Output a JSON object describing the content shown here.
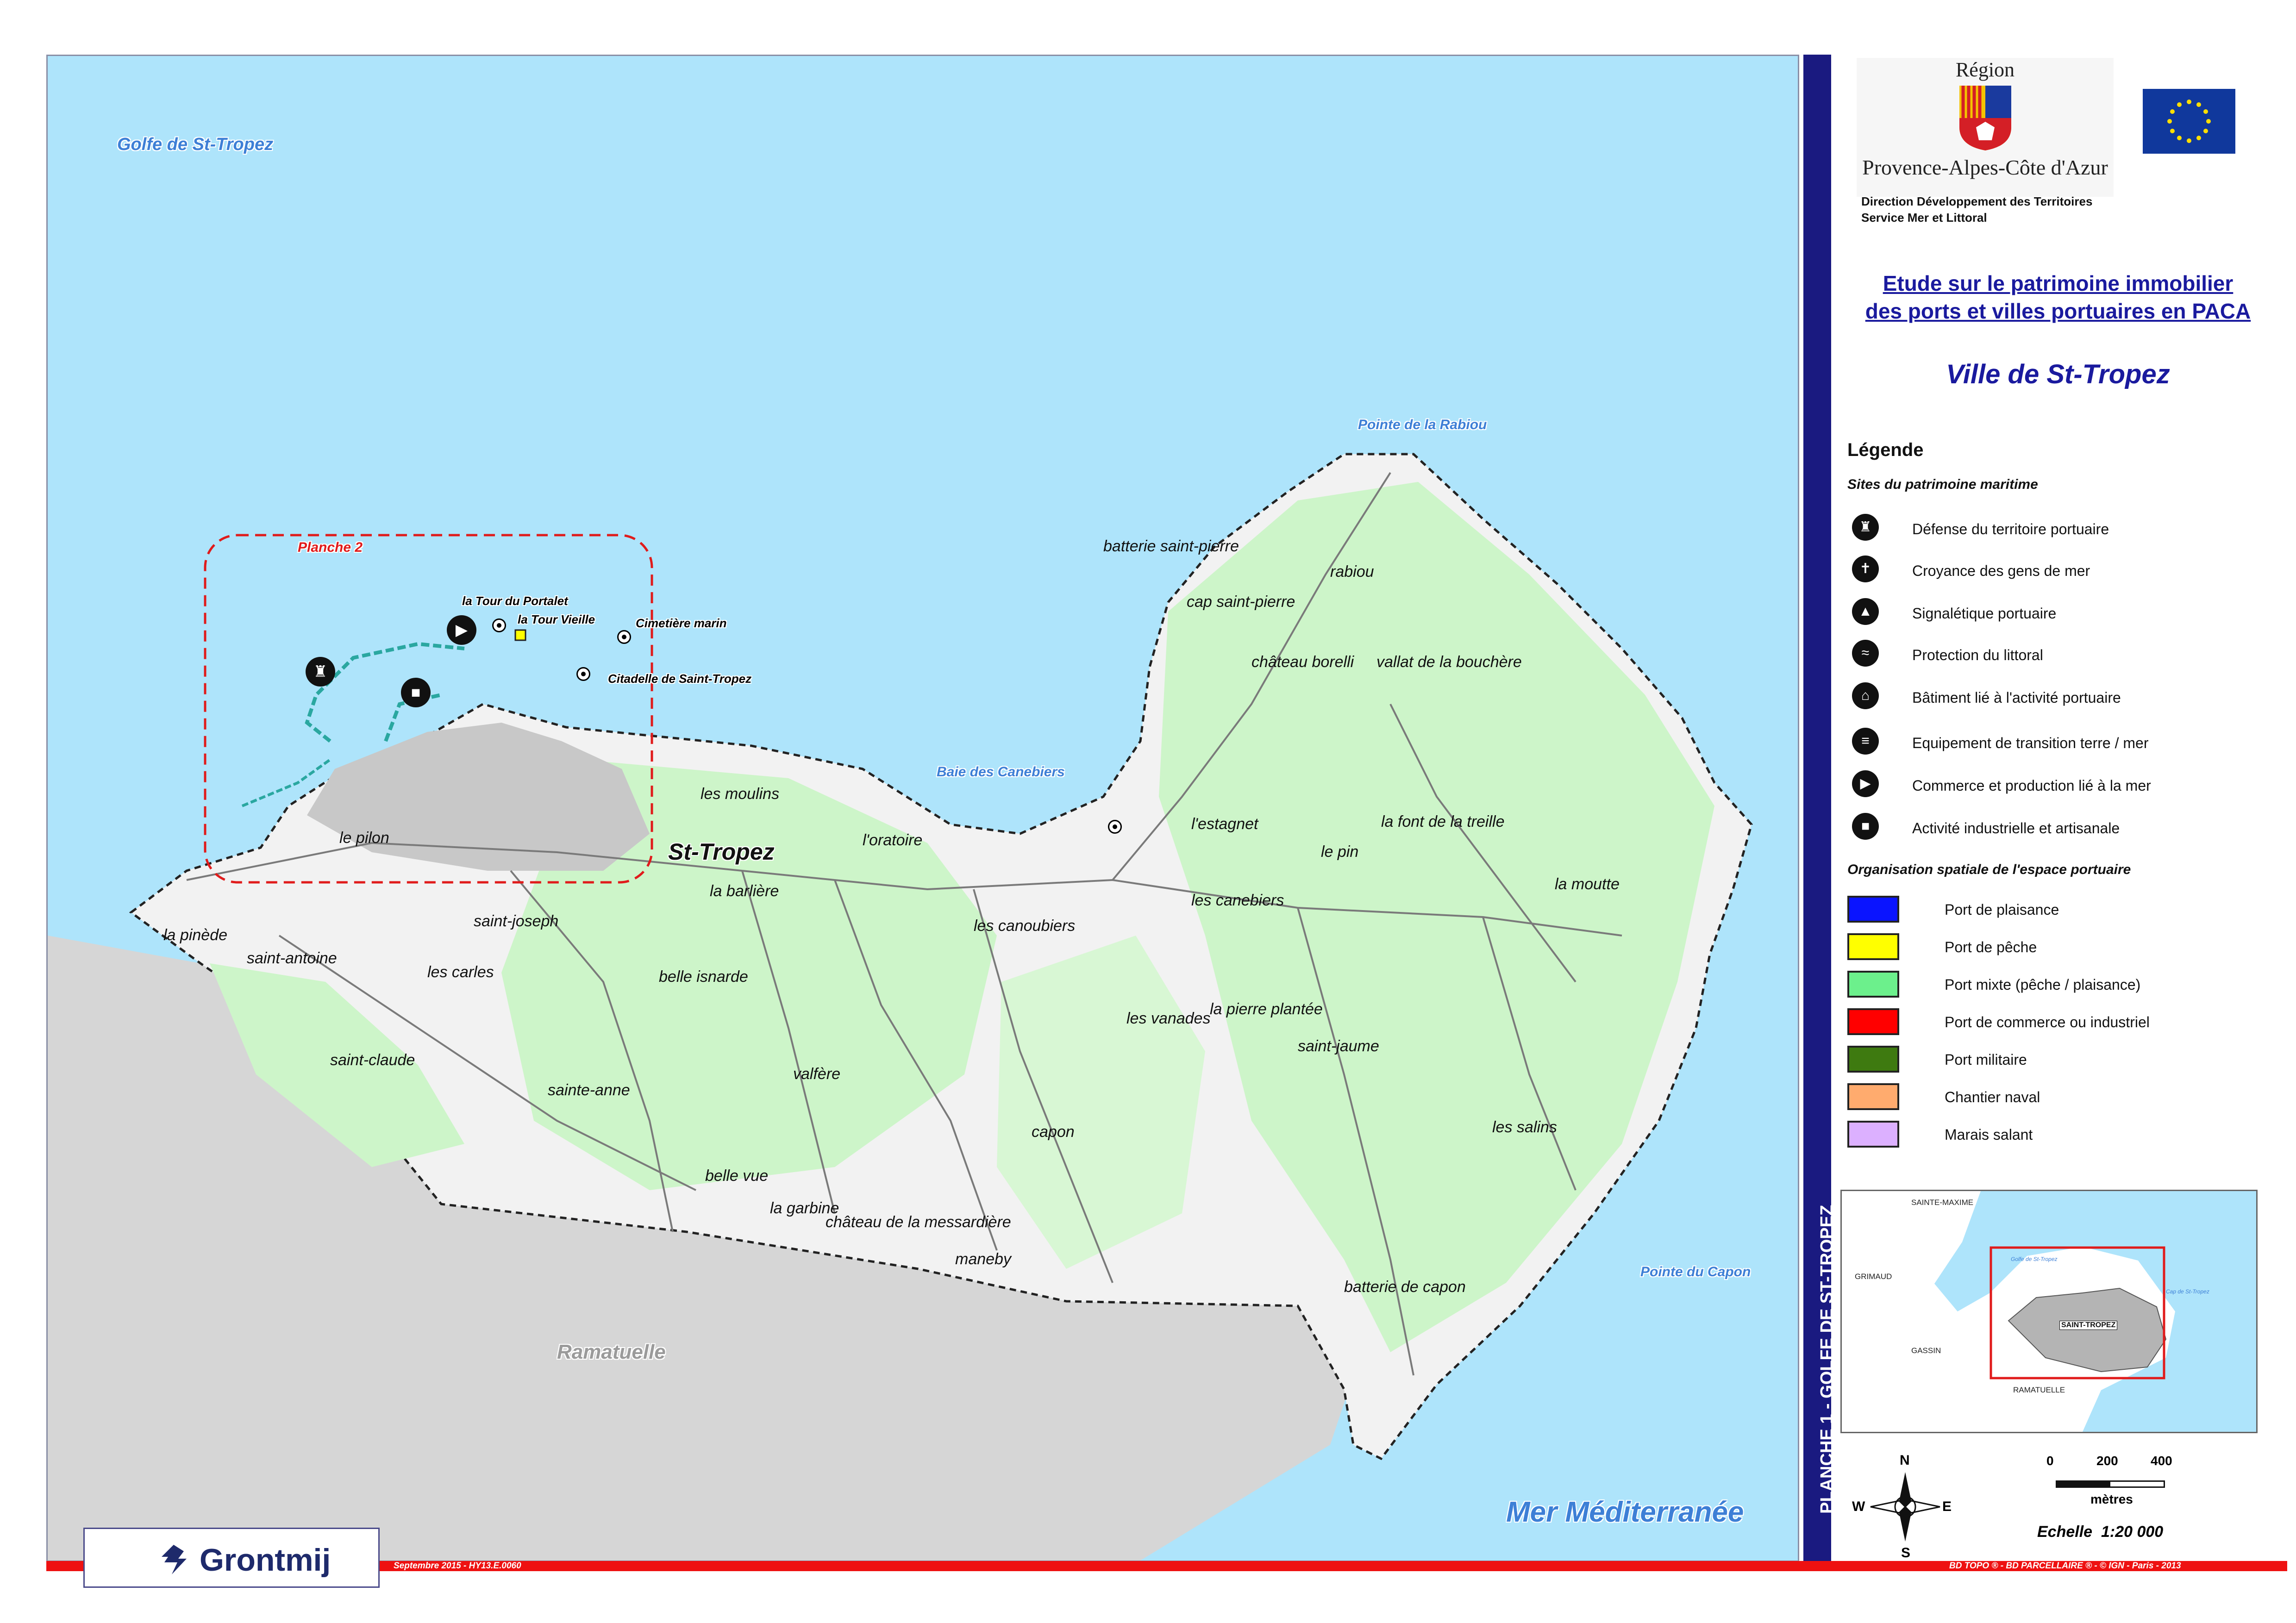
{
  "map": {
    "water_labels": {
      "golfe": "Golfe de St-Tropez",
      "rabiou_point": "Pointe de la Rabiou",
      "canebiers_bay": "Baie des Canebiers",
      "capon_point": "Pointe du Capon",
      "mer": "Mer Méditerranée"
    },
    "planche_label": "Planche 2",
    "town_label": "St-Tropez",
    "ramatuelle_label": "Ramatuelle",
    "sites": {
      "portalet": "la Tour du Portalet",
      "vieille": "la Tour Vieille",
      "cimetiere": "Cimetière marin",
      "citadelle": "Citadelle de Saint-Tropez"
    },
    "places": {
      "batterie_pierre": "batterie saint-pierre",
      "rabiou": "rabiou",
      "cap_pierre": "cap saint-pierre",
      "borelli": "château borelli",
      "vallat": "vallat de la bouchère",
      "moulins": "les moulins",
      "oratoire": "l'oratoire",
      "estagnet": "l'estagnet",
      "font_treille": "la font de la treille",
      "le_pin": "le pin",
      "moutte": "la moutte",
      "le_pilon": "le pilon",
      "barliere": "la barlière",
      "canebiers": "les canebiers",
      "pinede": "la pinède",
      "saint_joseph": "saint-joseph",
      "canoubiers": "les canoubiers",
      "saint_antoine": "saint-antoine",
      "les_carles": "les carles",
      "belle_isnarde": "belle isnarde",
      "vanades": "les vanades",
      "pierre_plantee": "la pierre plantée",
      "saint_claude": "saint-claude",
      "saint_jaume": "saint-jaume",
      "valfere": "valfère",
      "sainte_anne": "sainte-anne",
      "capon": "capon",
      "salins": "les salins",
      "belle_vue": "belle vue",
      "garbine": "la garbine",
      "messardiere": "château de la messardière",
      "maneby": "maneby",
      "batterie_capon": "batterie de capon"
    }
  },
  "sidebar_vertical": "PLANCHE 1 - GOLFE DE ST-TROPEZ",
  "header": {
    "region_word": "Région",
    "region_name": "Provence-Alpes-Côte d'Azur",
    "direction": "Direction Développement des Territoires",
    "service": "Service Mer et Littoral",
    "study_title_line1": "Etude sur le patrimoine immobilier",
    "study_title_line2": "des ports et villes portuaires en PACA",
    "city_title": "Ville de St-Tropez"
  },
  "legend": {
    "title": "Légende",
    "sites_subtitle": "Sites du patrimoine maritime",
    "sites": [
      {
        "label": "Défense du territoire portuaire",
        "icon": "castle-icon"
      },
      {
        "label": "Croyance des gens de mer",
        "icon": "church-icon"
      },
      {
        "label": "Signalétique portuaire",
        "icon": "lighthouse-icon"
      },
      {
        "label": "Protection du littoral",
        "icon": "wave-icon"
      },
      {
        "label": "Bâtiment lié à l'activité portuaire",
        "icon": "house-icon"
      },
      {
        "label": "Equipement de transition terre / mer",
        "icon": "slipway-icon"
      },
      {
        "label": "Commerce et production lié à la mer",
        "icon": "fish-icon"
      },
      {
        "label": "Activité industrielle et artisanale",
        "icon": "factory-icon"
      }
    ],
    "org_subtitle": "Organisation spatiale de l'espace portuaire",
    "zones": [
      {
        "label": "Port de plaisance",
        "color": "#0a14ff"
      },
      {
        "label": "Port de pêche",
        "color": "#ffff00"
      },
      {
        "label": "Port mixte (pêche / plaisance)",
        "color": "#6cf08c"
      },
      {
        "label": "Port de commerce ou industriel",
        "color": "#ff0000"
      },
      {
        "label": "Port militaire",
        "color": "#3e7a10"
      },
      {
        "label": "Chantier naval",
        "color": "#ffab6e"
      },
      {
        "label": "Marais salant",
        "color": "#dcb0ff"
      }
    ]
  },
  "inset": {
    "sainte_maxime": "SAINTE-MAXIME",
    "grimaud": "GRIMAUD",
    "gassin": "GASSIN",
    "ramatuelle": "RAMATUELLE",
    "saint_tropez": "SAINT-TROPEZ",
    "golfe": "Golfe de St-Tropez",
    "cap": "Cap de St-Tropez"
  },
  "compass": {
    "n": "N",
    "s": "S",
    "e": "E",
    "w": "W"
  },
  "scale": {
    "t0": "0",
    "t1": "200",
    "t2": "400",
    "unit": "mètres",
    "ratio": "Echelle  1:20 000"
  },
  "footer": {
    "date_ref": "Septembre 2015 - HY13.E.0060",
    "sources": "BD TOPO ® - BD PARCELLAIRE ® - © IGN - Paris - 2013",
    "company": "Grontmij"
  },
  "colors": {
    "sea": "#aee4fb",
    "land": "#f2f2f2",
    "vegetation": "#cdf5c9",
    "other_commune": "#d6d6d6",
    "accent_blue": "#1a1a80",
    "accent_red": "#ee1111"
  }
}
